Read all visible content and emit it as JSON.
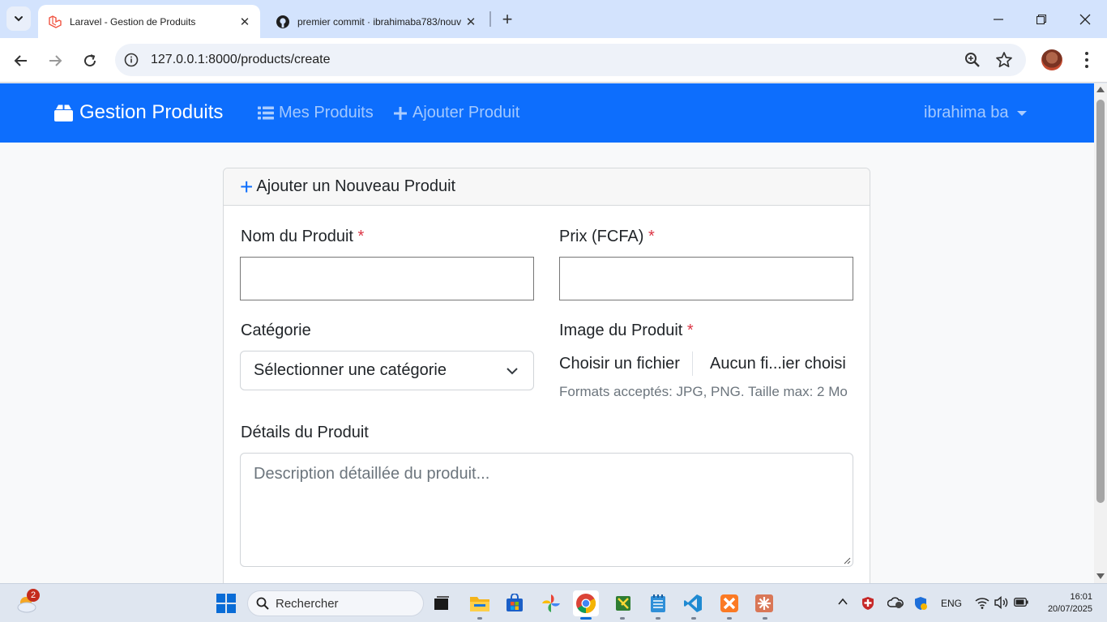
{
  "browser": {
    "tabs": [
      {
        "title": "Laravel - Gestion de Produits",
        "active": true
      },
      {
        "title": "premier commit · ibrahimaba783/nouv",
        "active": false
      }
    ],
    "url": "127.0.0.1:8000/products/create"
  },
  "navbar": {
    "brand": "Gestion Produits",
    "links": [
      {
        "label": "Mes Produits"
      },
      {
        "label": "Ajouter Produit"
      }
    ],
    "user": "ibrahima ba"
  },
  "form": {
    "title": "Ajouter un Nouveau Produit",
    "name_label": "Nom du Produit",
    "price_label": "Prix (FCFA)",
    "required_mark": "*",
    "category_label": "Catégorie",
    "category_selected": "Sélectionner une catégorie",
    "image_label": "Image du Produit",
    "file_button": "Choisir un fichier",
    "file_name": "Aucun fi...ier choisi",
    "image_help": "Formats acceptés: JPG, PNG. Taille max: 2 Mo",
    "details_label": "Détails du Produit",
    "details_placeholder": "Description détaillée du produit..."
  },
  "taskbar": {
    "weather_badge": "2",
    "search_placeholder": "Rechercher",
    "language": "ENG",
    "time": "16:01",
    "date": "20/07/2025"
  },
  "colors": {
    "primary": "#0d6efd",
    "danger": "#dc3545",
    "muted": "#6c757d"
  }
}
